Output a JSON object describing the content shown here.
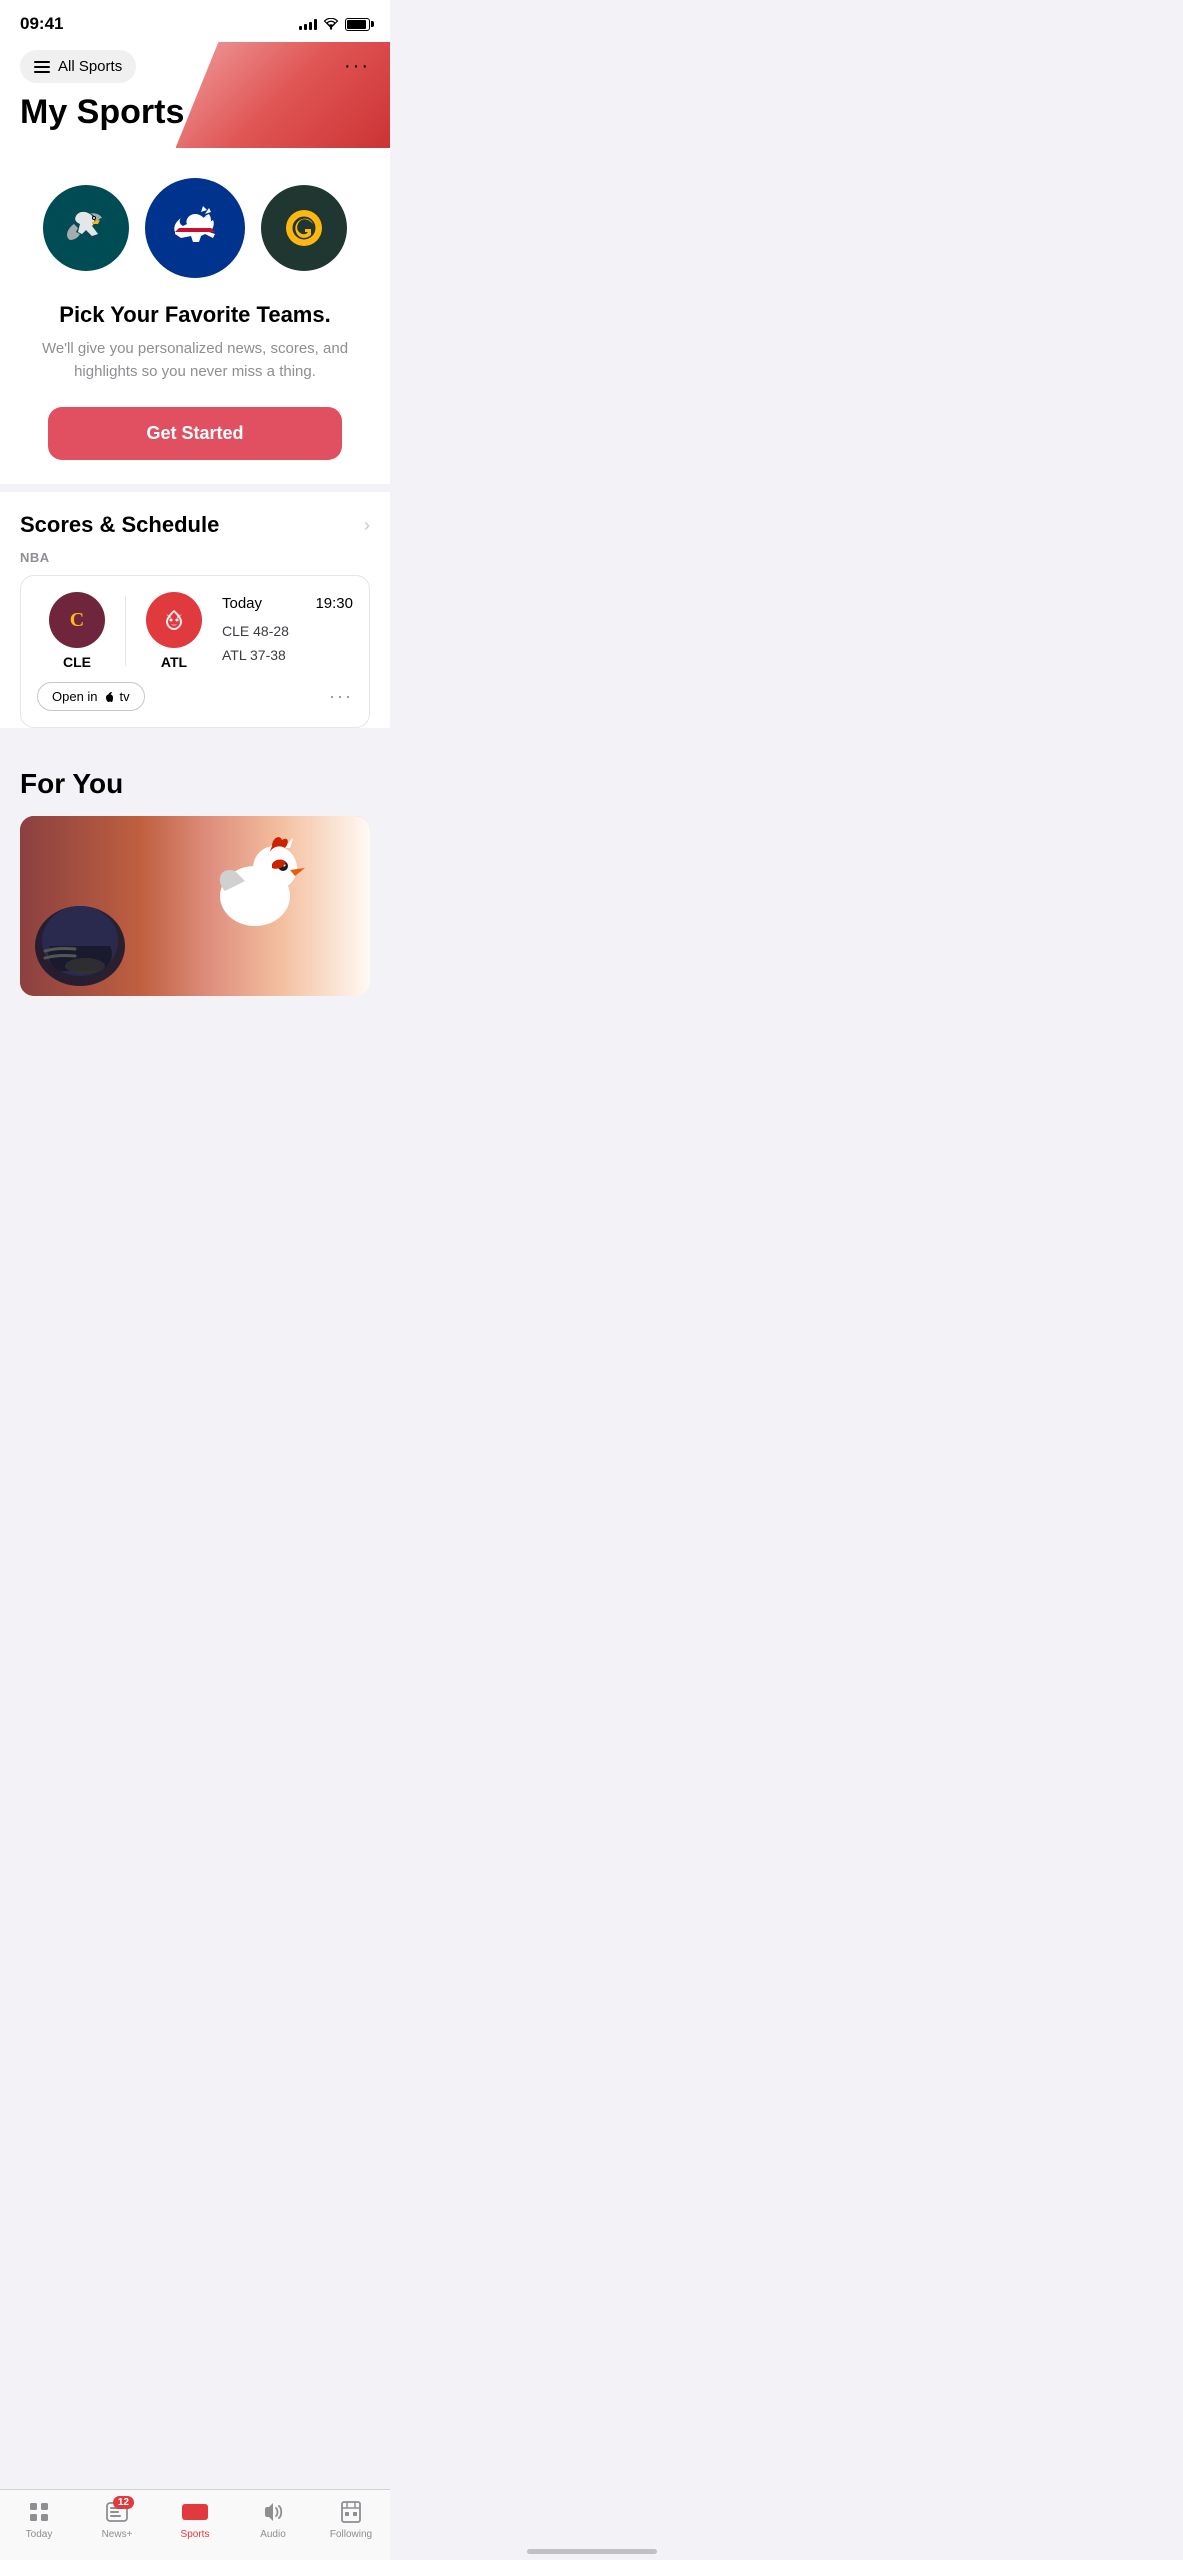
{
  "statusBar": {
    "time": "09:41"
  },
  "header": {
    "allSportsLabel": "All Sports",
    "moreLabel": "···",
    "title": "My Sports"
  },
  "teamsSection": {
    "teams": [
      {
        "name": "Eagles",
        "abbr": "PHI",
        "colorClass": "eagles"
      },
      {
        "name": "Bills",
        "abbr": "BUF",
        "colorClass": "bills"
      },
      {
        "name": "Packers",
        "abbr": "GB",
        "colorClass": "packers"
      }
    ],
    "pickTitle": "Pick Your Favorite Teams.",
    "pickSubtitle": "We'll give you personalized news, scores, and highlights so you never miss a thing.",
    "getStartedLabel": "Get Started"
  },
  "scoresSection": {
    "title": "Scores & Schedule",
    "leagueLabel": "NBA",
    "game": {
      "team1": {
        "abbr": "CLE",
        "badgeClass": "cavs"
      },
      "team2": {
        "abbr": "ATL",
        "badgeClass": "hawks"
      },
      "day": "Today",
      "time": "19:30",
      "record1": "CLE 48-28",
      "record2": "ATL 37-38",
      "openLabel": "Open in",
      "tvLabel": "tv"
    }
  },
  "forYouSection": {
    "title": "For You"
  },
  "tabBar": {
    "tabs": [
      {
        "label": "Today",
        "active": false,
        "badge": null
      },
      {
        "label": "News+",
        "active": false,
        "badge": "12"
      },
      {
        "label": "Sports",
        "active": true,
        "badge": null
      },
      {
        "label": "Audio",
        "active": false,
        "badge": null
      },
      {
        "label": "Following",
        "active": false,
        "badge": null
      }
    ]
  }
}
